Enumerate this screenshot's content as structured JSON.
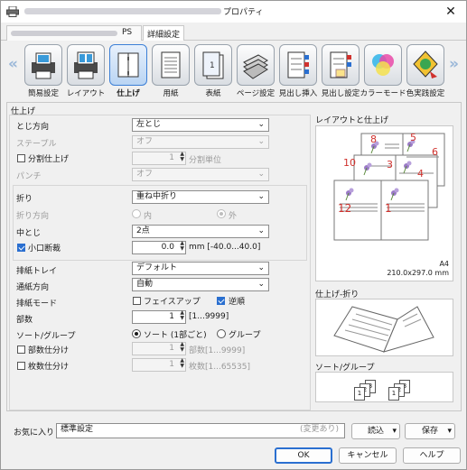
{
  "window": {
    "title_suffix": "プロパティ",
    "close_glyph": "✕"
  },
  "tabs": [
    {
      "label": "PS"
    },
    {
      "label": "詳細設定"
    }
  ],
  "categories": [
    {
      "label": "簡易設定",
      "icon": "printer-photo-icon"
    },
    {
      "label": "レイアウト",
      "icon": "layout-printer-icon"
    },
    {
      "label": "仕上げ",
      "icon": "finishing-icon",
      "selected": true
    },
    {
      "label": "用紙",
      "icon": "paper-icon"
    },
    {
      "label": "表紙",
      "icon": "cover-icon"
    },
    {
      "label": "ページ設定",
      "icon": "page-setup-icon"
    },
    {
      "label": "見出し挿入",
      "icon": "tab-insert-icon"
    },
    {
      "label": "見出し設定",
      "icon": "tab-settings-icon"
    },
    {
      "label": "カラーモード",
      "icon": "color-mode-icon"
    },
    {
      "label": "色実践設定",
      "icon": "color-practice-icon"
    }
  ],
  "finishing": {
    "section_title": "仕上げ",
    "binding_dir": {
      "label": "とじ方向",
      "value": "左とじ"
    },
    "staple": {
      "label": "ステープル",
      "value": "オフ"
    },
    "split": {
      "label": "分割仕上げ",
      "value": "1",
      "unit": "分割単位",
      "checked": false
    },
    "punch": {
      "label": "パンチ",
      "value": "オフ"
    },
    "fold": {
      "label": "折り",
      "value": "重ね中折り"
    },
    "fold_dir": {
      "label": "折り方向",
      "opt_in": "内",
      "opt_out": "外"
    },
    "saddle": {
      "label": "中とじ",
      "value": "2点"
    },
    "trim": {
      "label": "小口断裁",
      "value": "0.0",
      "range": "mm [-40.0...40.0]",
      "checked": true
    },
    "output_tray": {
      "label": "排紙トレイ",
      "value": "デフォルト"
    },
    "feed_dir": {
      "label": "通紙方向",
      "value": "自動"
    },
    "output_mode": {
      "label": "排紙モード",
      "opt_faceup": "フェイスアップ",
      "opt_reverse": "逆順",
      "faceup_checked": false,
      "reverse_checked": true
    },
    "copies": {
      "label": "部数",
      "value": "1",
      "range": "[1...9999]"
    },
    "sort": {
      "label": "ソート/グループ",
      "opt_sort": "ソート (1部ごと)",
      "opt_group": "グループ"
    },
    "set_sep": {
      "label": "部数仕分け",
      "value": "1",
      "range": "部数[1...9999]"
    },
    "sheet_sep": {
      "label": "枚数仕分け",
      "value": "1",
      "range": "枚数[1...65535]"
    }
  },
  "preview": {
    "layout_title": "レイアウトと仕上げ",
    "paper_name": "A4",
    "paper_size": "210.0x297.0 mm",
    "page_nums": [
      "8",
      "5",
      "6",
      "10",
      "3",
      "4",
      "12",
      "1"
    ],
    "fold_title": "仕上げ-折り",
    "sort_title": "ソート/グループ",
    "sort_pages": [
      "3",
      "2",
      "1",
      "3",
      "2",
      "1"
    ]
  },
  "footer": {
    "favorites_label": "お気に入り",
    "favorites_value": "標準設定",
    "favorites_status": "(変更あり)",
    "load_label": "読込",
    "save_label": "保存",
    "ok_label": "OK",
    "cancel_label": "キャンセル",
    "help_label": "ヘルプ"
  },
  "colors": {
    "accent": "#2a6fd0",
    "page_number": "#d0312d"
  }
}
